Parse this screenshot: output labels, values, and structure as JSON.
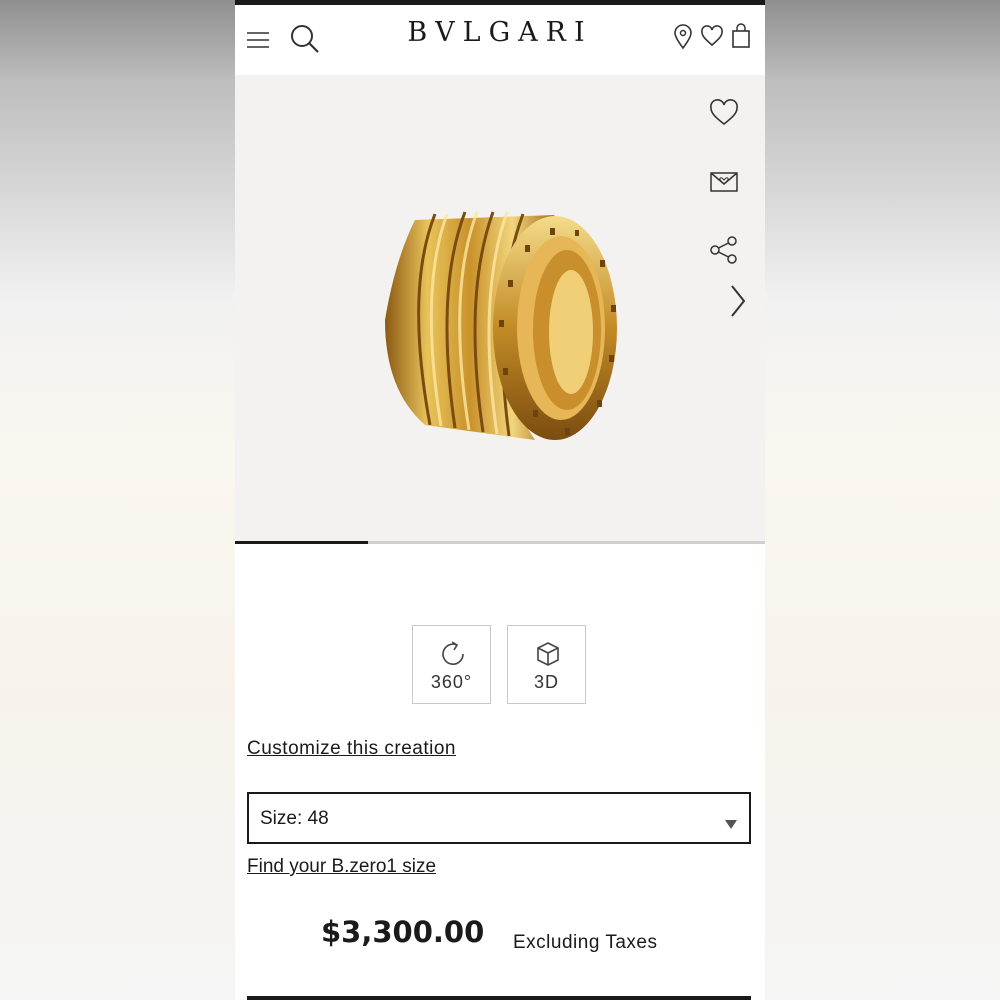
{
  "header": {
    "brand": "BVLGARI",
    "icons": [
      "menu-icon",
      "search-icon",
      "location-pin-icon",
      "wishlist-heart-icon",
      "shopping-bag-icon"
    ]
  },
  "gallery": {
    "image_alt": "B.zero1 ring in yellow gold",
    "side_icons": [
      "heart-icon",
      "mail-icon",
      "share-icon",
      "chevron-right-icon"
    ],
    "progress": 0.25
  },
  "views": [
    {
      "label": "360°",
      "icon": "rotate-icon"
    },
    {
      "label": "3D",
      "icon": "cube-icon"
    }
  ],
  "customize_label": "Customize this creation",
  "size_select": {
    "value": "Size: 48",
    "icon": "caret-down-icon"
  },
  "find_size_label": "Find your B.zero1 size",
  "price": {
    "amount": "$3,300.00",
    "note": "Excluding Taxes"
  },
  "colors": {
    "accent": "#1a1a1a",
    "gold": "#d4a437",
    "gallery_bg": "#f3f2f0"
  }
}
